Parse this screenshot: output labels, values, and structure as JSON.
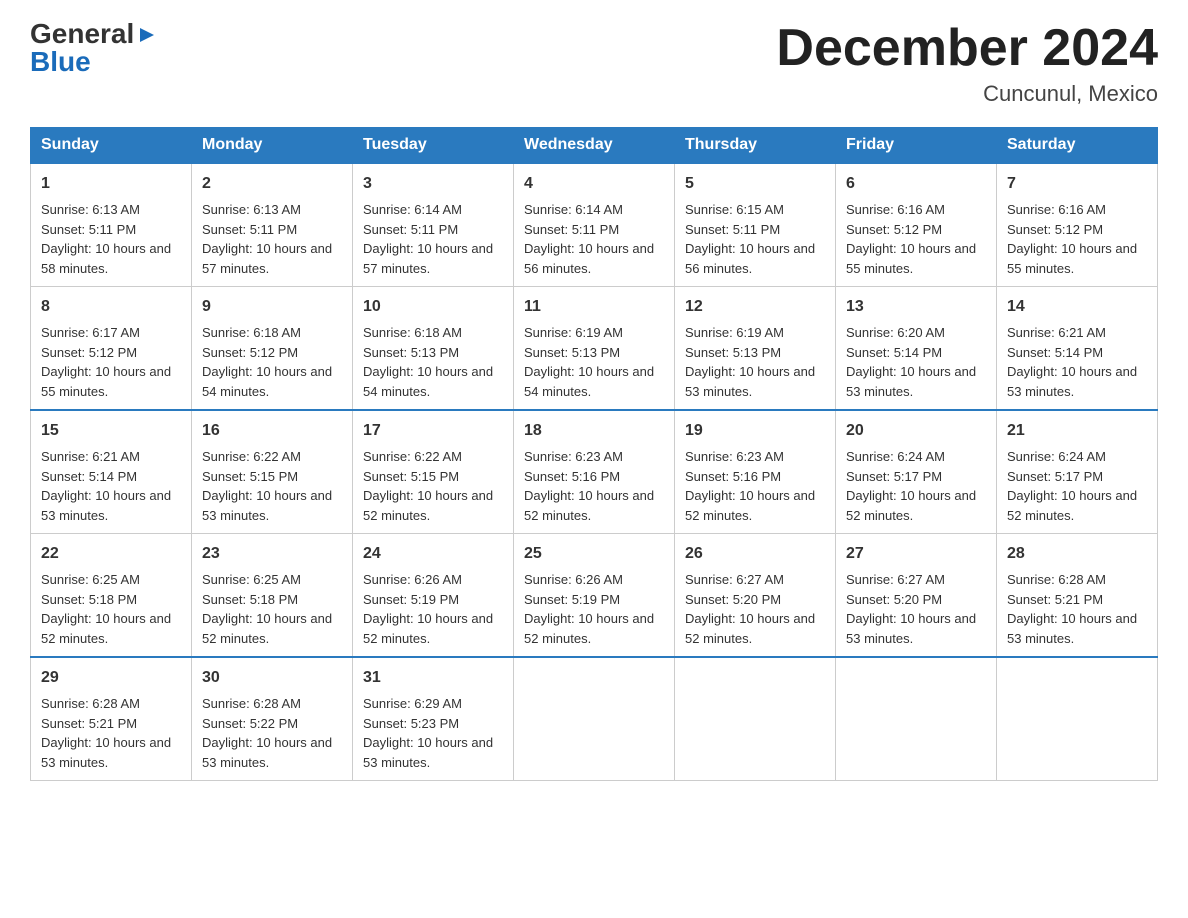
{
  "logo": {
    "general": "General",
    "blue": "Blue",
    "triangle": "▶"
  },
  "title": "December 2024",
  "subtitle": "Cuncunul, Mexico",
  "days": [
    "Sunday",
    "Monday",
    "Tuesday",
    "Wednesday",
    "Thursday",
    "Friday",
    "Saturday"
  ],
  "weeks": [
    [
      {
        "num": "1",
        "sunrise": "6:13 AM",
        "sunset": "5:11 PM",
        "daylight": "10 hours and 58 minutes."
      },
      {
        "num": "2",
        "sunrise": "6:13 AM",
        "sunset": "5:11 PM",
        "daylight": "10 hours and 57 minutes."
      },
      {
        "num": "3",
        "sunrise": "6:14 AM",
        "sunset": "5:11 PM",
        "daylight": "10 hours and 57 minutes."
      },
      {
        "num": "4",
        "sunrise": "6:14 AM",
        "sunset": "5:11 PM",
        "daylight": "10 hours and 56 minutes."
      },
      {
        "num": "5",
        "sunrise": "6:15 AM",
        "sunset": "5:11 PM",
        "daylight": "10 hours and 56 minutes."
      },
      {
        "num": "6",
        "sunrise": "6:16 AM",
        "sunset": "5:12 PM",
        "daylight": "10 hours and 55 minutes."
      },
      {
        "num": "7",
        "sunrise": "6:16 AM",
        "sunset": "5:12 PM",
        "daylight": "10 hours and 55 minutes."
      }
    ],
    [
      {
        "num": "8",
        "sunrise": "6:17 AM",
        "sunset": "5:12 PM",
        "daylight": "10 hours and 55 minutes."
      },
      {
        "num": "9",
        "sunrise": "6:18 AM",
        "sunset": "5:12 PM",
        "daylight": "10 hours and 54 minutes."
      },
      {
        "num": "10",
        "sunrise": "6:18 AM",
        "sunset": "5:13 PM",
        "daylight": "10 hours and 54 minutes."
      },
      {
        "num": "11",
        "sunrise": "6:19 AM",
        "sunset": "5:13 PM",
        "daylight": "10 hours and 54 minutes."
      },
      {
        "num": "12",
        "sunrise": "6:19 AM",
        "sunset": "5:13 PM",
        "daylight": "10 hours and 53 minutes."
      },
      {
        "num": "13",
        "sunrise": "6:20 AM",
        "sunset": "5:14 PM",
        "daylight": "10 hours and 53 minutes."
      },
      {
        "num": "14",
        "sunrise": "6:21 AM",
        "sunset": "5:14 PM",
        "daylight": "10 hours and 53 minutes."
      }
    ],
    [
      {
        "num": "15",
        "sunrise": "6:21 AM",
        "sunset": "5:14 PM",
        "daylight": "10 hours and 53 minutes."
      },
      {
        "num": "16",
        "sunrise": "6:22 AM",
        "sunset": "5:15 PM",
        "daylight": "10 hours and 53 minutes."
      },
      {
        "num": "17",
        "sunrise": "6:22 AM",
        "sunset": "5:15 PM",
        "daylight": "10 hours and 52 minutes."
      },
      {
        "num": "18",
        "sunrise": "6:23 AM",
        "sunset": "5:16 PM",
        "daylight": "10 hours and 52 minutes."
      },
      {
        "num": "19",
        "sunrise": "6:23 AM",
        "sunset": "5:16 PM",
        "daylight": "10 hours and 52 minutes."
      },
      {
        "num": "20",
        "sunrise": "6:24 AM",
        "sunset": "5:17 PM",
        "daylight": "10 hours and 52 minutes."
      },
      {
        "num": "21",
        "sunrise": "6:24 AM",
        "sunset": "5:17 PM",
        "daylight": "10 hours and 52 minutes."
      }
    ],
    [
      {
        "num": "22",
        "sunrise": "6:25 AM",
        "sunset": "5:18 PM",
        "daylight": "10 hours and 52 minutes."
      },
      {
        "num": "23",
        "sunrise": "6:25 AM",
        "sunset": "5:18 PM",
        "daylight": "10 hours and 52 minutes."
      },
      {
        "num": "24",
        "sunrise": "6:26 AM",
        "sunset": "5:19 PM",
        "daylight": "10 hours and 52 minutes."
      },
      {
        "num": "25",
        "sunrise": "6:26 AM",
        "sunset": "5:19 PM",
        "daylight": "10 hours and 52 minutes."
      },
      {
        "num": "26",
        "sunrise": "6:27 AM",
        "sunset": "5:20 PM",
        "daylight": "10 hours and 52 minutes."
      },
      {
        "num": "27",
        "sunrise": "6:27 AM",
        "sunset": "5:20 PM",
        "daylight": "10 hours and 53 minutes."
      },
      {
        "num": "28",
        "sunrise": "6:28 AM",
        "sunset": "5:21 PM",
        "daylight": "10 hours and 53 minutes."
      }
    ],
    [
      {
        "num": "29",
        "sunrise": "6:28 AM",
        "sunset": "5:21 PM",
        "daylight": "10 hours and 53 minutes."
      },
      {
        "num": "30",
        "sunrise": "6:28 AM",
        "sunset": "5:22 PM",
        "daylight": "10 hours and 53 minutes."
      },
      {
        "num": "31",
        "sunrise": "6:29 AM",
        "sunset": "5:23 PM",
        "daylight": "10 hours and 53 minutes."
      },
      null,
      null,
      null,
      null
    ]
  ]
}
